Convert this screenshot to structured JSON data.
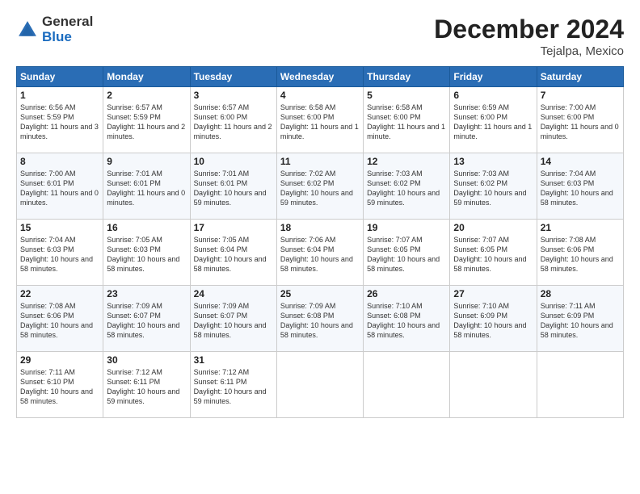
{
  "logo": {
    "general": "General",
    "blue": "Blue"
  },
  "title": "December 2024",
  "subtitle": "Tejalpa, Mexico",
  "days_header": [
    "Sunday",
    "Monday",
    "Tuesday",
    "Wednesday",
    "Thursday",
    "Friday",
    "Saturday"
  ],
  "weeks": [
    [
      {
        "day": "1",
        "sunrise": "6:56 AM",
        "sunset": "5:59 PM",
        "daylight": "11 hours and 3 minutes."
      },
      {
        "day": "2",
        "sunrise": "6:57 AM",
        "sunset": "5:59 PM",
        "daylight": "11 hours and 2 minutes."
      },
      {
        "day": "3",
        "sunrise": "6:57 AM",
        "sunset": "6:00 PM",
        "daylight": "11 hours and 2 minutes."
      },
      {
        "day": "4",
        "sunrise": "6:58 AM",
        "sunset": "6:00 PM",
        "daylight": "11 hours and 1 minute."
      },
      {
        "day": "5",
        "sunrise": "6:58 AM",
        "sunset": "6:00 PM",
        "daylight": "11 hours and 1 minute."
      },
      {
        "day": "6",
        "sunrise": "6:59 AM",
        "sunset": "6:00 PM",
        "daylight": "11 hours and 1 minute."
      },
      {
        "day": "7",
        "sunrise": "7:00 AM",
        "sunset": "6:00 PM",
        "daylight": "11 hours and 0 minutes."
      }
    ],
    [
      {
        "day": "8",
        "sunrise": "7:00 AM",
        "sunset": "6:01 PM",
        "daylight": "11 hours and 0 minutes."
      },
      {
        "day": "9",
        "sunrise": "7:01 AM",
        "sunset": "6:01 PM",
        "daylight": "11 hours and 0 minutes."
      },
      {
        "day": "10",
        "sunrise": "7:01 AM",
        "sunset": "6:01 PM",
        "daylight": "10 hours and 59 minutes."
      },
      {
        "day": "11",
        "sunrise": "7:02 AM",
        "sunset": "6:02 PM",
        "daylight": "10 hours and 59 minutes."
      },
      {
        "day": "12",
        "sunrise": "7:03 AM",
        "sunset": "6:02 PM",
        "daylight": "10 hours and 59 minutes."
      },
      {
        "day": "13",
        "sunrise": "7:03 AM",
        "sunset": "6:02 PM",
        "daylight": "10 hours and 59 minutes."
      },
      {
        "day": "14",
        "sunrise": "7:04 AM",
        "sunset": "6:03 PM",
        "daylight": "10 hours and 58 minutes."
      }
    ],
    [
      {
        "day": "15",
        "sunrise": "7:04 AM",
        "sunset": "6:03 PM",
        "daylight": "10 hours and 58 minutes."
      },
      {
        "day": "16",
        "sunrise": "7:05 AM",
        "sunset": "6:03 PM",
        "daylight": "10 hours and 58 minutes."
      },
      {
        "day": "17",
        "sunrise": "7:05 AM",
        "sunset": "6:04 PM",
        "daylight": "10 hours and 58 minutes."
      },
      {
        "day": "18",
        "sunrise": "7:06 AM",
        "sunset": "6:04 PM",
        "daylight": "10 hours and 58 minutes."
      },
      {
        "day": "19",
        "sunrise": "7:07 AM",
        "sunset": "6:05 PM",
        "daylight": "10 hours and 58 minutes."
      },
      {
        "day": "20",
        "sunrise": "7:07 AM",
        "sunset": "6:05 PM",
        "daylight": "10 hours and 58 minutes."
      },
      {
        "day": "21",
        "sunrise": "7:08 AM",
        "sunset": "6:06 PM",
        "daylight": "10 hours and 58 minutes."
      }
    ],
    [
      {
        "day": "22",
        "sunrise": "7:08 AM",
        "sunset": "6:06 PM",
        "daylight": "10 hours and 58 minutes."
      },
      {
        "day": "23",
        "sunrise": "7:09 AM",
        "sunset": "6:07 PM",
        "daylight": "10 hours and 58 minutes."
      },
      {
        "day": "24",
        "sunrise": "7:09 AM",
        "sunset": "6:07 PM",
        "daylight": "10 hours and 58 minutes."
      },
      {
        "day": "25",
        "sunrise": "7:09 AM",
        "sunset": "6:08 PM",
        "daylight": "10 hours and 58 minutes."
      },
      {
        "day": "26",
        "sunrise": "7:10 AM",
        "sunset": "6:08 PM",
        "daylight": "10 hours and 58 minutes."
      },
      {
        "day": "27",
        "sunrise": "7:10 AM",
        "sunset": "6:09 PM",
        "daylight": "10 hours and 58 minutes."
      },
      {
        "day": "28",
        "sunrise": "7:11 AM",
        "sunset": "6:09 PM",
        "daylight": "10 hours and 58 minutes."
      }
    ],
    [
      {
        "day": "29",
        "sunrise": "7:11 AM",
        "sunset": "6:10 PM",
        "daylight": "10 hours and 58 minutes."
      },
      {
        "day": "30",
        "sunrise": "7:12 AM",
        "sunset": "6:11 PM",
        "daylight": "10 hours and 59 minutes."
      },
      {
        "day": "31",
        "sunrise": "7:12 AM",
        "sunset": "6:11 PM",
        "daylight": "10 hours and 59 minutes."
      },
      null,
      null,
      null,
      null
    ]
  ]
}
